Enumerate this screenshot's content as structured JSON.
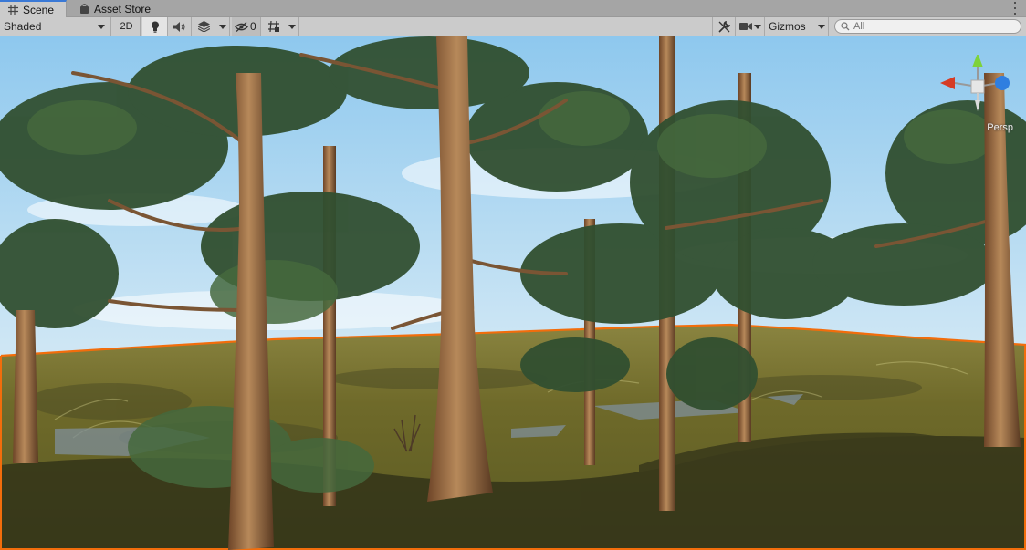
{
  "tabs": [
    {
      "label": "Scene",
      "icon": "hash-icon",
      "active": true
    },
    {
      "label": "Asset Store",
      "icon": "shopping-bag-icon",
      "active": false
    }
  ],
  "toolbar": {
    "draw_mode": "Shaded",
    "btn_2d": "2D",
    "hidden_count": "0",
    "gizmos_label": "Gizmos",
    "search_placeholder": "All"
  },
  "scene": {
    "projection_label": "Persp",
    "colors": {
      "sky_top": "#9fd0f0",
      "sky_bottom": "#e7f2f7",
      "terrain": "#7d7a2e",
      "terrain_dark": "#34331c",
      "selection_outline": "#f26d0c",
      "foliage": "#2f4d2f",
      "trunk": "#9b6a3f"
    }
  }
}
